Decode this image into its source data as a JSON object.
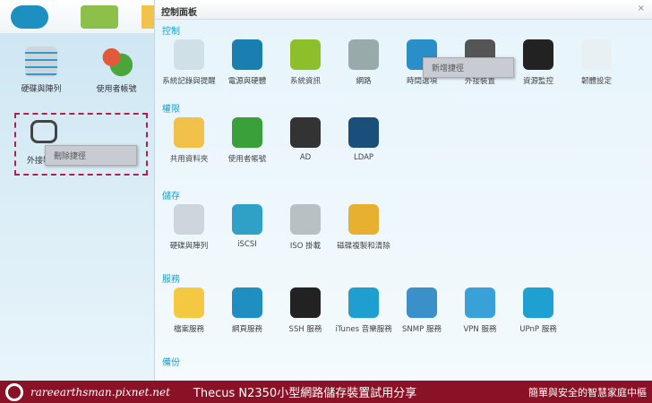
{
  "desktop": {
    "items": [
      {
        "label": "硬碟與陣列"
      },
      {
        "label": "使用者帳號"
      },
      {
        "label": "外接裝置"
      }
    ],
    "context_menu": "刪除捷徑"
  },
  "panel": {
    "title": "控制面板",
    "close": "×",
    "context_menu": "新增捷徑",
    "sections": [
      {
        "title": "控制",
        "items": [
          "系統記錄與提醒",
          "電源與硬體",
          "系統資訊",
          "網路",
          "時間選項",
          "外接裝置",
          "資源監控",
          "韌體設定"
        ]
      },
      {
        "title": "權限",
        "items": [
          "共用資料夾",
          "使用者帳號",
          "AD",
          "LDAP"
        ]
      },
      {
        "title": "儲存",
        "items": [
          "硬碟與陣列",
          "iSCSI",
          "ISO 掛載",
          "磁碟複製和清除"
        ]
      },
      {
        "title": "服務",
        "items": [
          "檔案服務",
          "網頁服務",
          "SSH 服務",
          "iTunes 音樂服務",
          "SNMP 服務",
          "VPN 服務",
          "UPnP 服務"
        ]
      },
      {
        "title": "備份",
        "items": []
      }
    ]
  },
  "footer": {
    "site": "rareearthsman.pixnet.net",
    "title": "Thecus N2350小型網路儲存裝置試用分享",
    "slogan": "簡單與安全的智慧家庭中樞"
  },
  "colors": {
    "accent": "#1aa0c8",
    "footer": "#8a1226",
    "dash": "#b0204a"
  }
}
